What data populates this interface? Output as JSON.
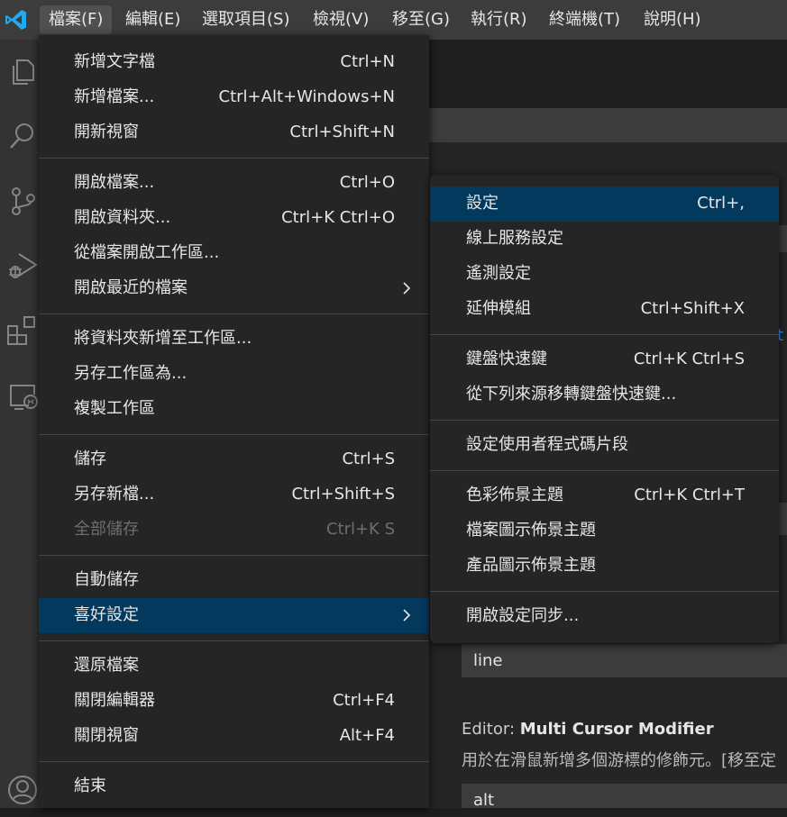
{
  "menubar": {
    "items": [
      "檔案(F)",
      "編輯(E)",
      "選取項目(S)",
      "檢視(V)",
      "移至(G)",
      "執行(R)",
      "終端機(T)",
      "說明(H)"
    ]
  },
  "activitybar": {
    "icons": [
      "explorer-icon",
      "search-icon",
      "source-control-icon",
      "run-debug-icon",
      "extensions-icon",
      "remote-explorer-icon",
      "account-icon"
    ]
  },
  "file_menu": {
    "groups": [
      [
        {
          "label": "新增文字檔",
          "shortcut": "Ctrl+N"
        },
        {
          "label": "新增檔案...",
          "shortcut": "Ctrl+Alt+Windows+N"
        },
        {
          "label": "開新視窗",
          "shortcut": "Ctrl+Shift+N"
        }
      ],
      [
        {
          "label": "開啟檔案...",
          "shortcut": "Ctrl+O"
        },
        {
          "label": "開啟資料夾...",
          "shortcut": "Ctrl+K Ctrl+O"
        },
        {
          "label": "從檔案開啟工作區...",
          "shortcut": ""
        },
        {
          "label": "開啟最近的檔案",
          "shortcut": "",
          "submenu": true
        }
      ],
      [
        {
          "label": "將資料夾新增至工作區...",
          "shortcut": ""
        },
        {
          "label": "另存工作區為...",
          "shortcut": ""
        },
        {
          "label": "複製工作區",
          "shortcut": ""
        }
      ],
      [
        {
          "label": "儲存",
          "shortcut": "Ctrl+S"
        },
        {
          "label": "另存新檔...",
          "shortcut": "Ctrl+Shift+S"
        },
        {
          "label": "全部儲存",
          "shortcut": "Ctrl+K S",
          "disabled": true
        }
      ],
      [
        {
          "label": "自動儲存",
          "shortcut": ""
        },
        {
          "label": "喜好設定",
          "shortcut": "",
          "submenu": true,
          "highlighted": true
        }
      ],
      [
        {
          "label": "還原檔案",
          "shortcut": ""
        },
        {
          "label": "關閉編輯器",
          "shortcut": "Ctrl+F4"
        },
        {
          "label": "關閉視窗",
          "shortcut": "Alt+F4"
        }
      ],
      [
        {
          "label": "結束",
          "shortcut": ""
        }
      ]
    ]
  },
  "preferences_menu": {
    "groups": [
      [
        {
          "label": "設定",
          "shortcut": "Ctrl+,",
          "highlighted": true
        },
        {
          "label": "線上服務設定",
          "shortcut": ""
        },
        {
          "label": "遙測設定",
          "shortcut": ""
        },
        {
          "label": "延伸模組",
          "shortcut": "Ctrl+Shift+X"
        }
      ],
      [
        {
          "label": "鍵盤快速鍵",
          "shortcut": "Ctrl+K Ctrl+S"
        },
        {
          "label": "從下列來源移轉鍵盤快速鍵...",
          "shortcut": ""
        }
      ],
      [
        {
          "label": "設定使用者程式碼片段",
          "shortcut": ""
        }
      ],
      [
        {
          "label": "色彩佈景主題",
          "shortcut": "Ctrl+K Ctrl+T"
        },
        {
          "label": "檔案圖示佈景主題",
          "shortcut": ""
        },
        {
          "label": "產品圖示佈景主題",
          "shortcut": ""
        }
      ],
      [
        {
          "label": "開啟設定同步...",
          "shortcut": ""
        }
      ]
    ]
  },
  "settings_background": {
    "line_value": "line",
    "multi_cursor_prefix": "Editor: ",
    "multi_cursor_title": "Multi Cursor Modifier",
    "multi_cursor_desc": "用於在滑鼠新增多個游標的修飾元。[移至定",
    "alt_value": "alt",
    "stray_char": "t"
  },
  "colors": {
    "accent": "#0078d4",
    "highlight": "#04395e",
    "menu_bg": "#252526",
    "titlebar": "#3c3c3c"
  }
}
